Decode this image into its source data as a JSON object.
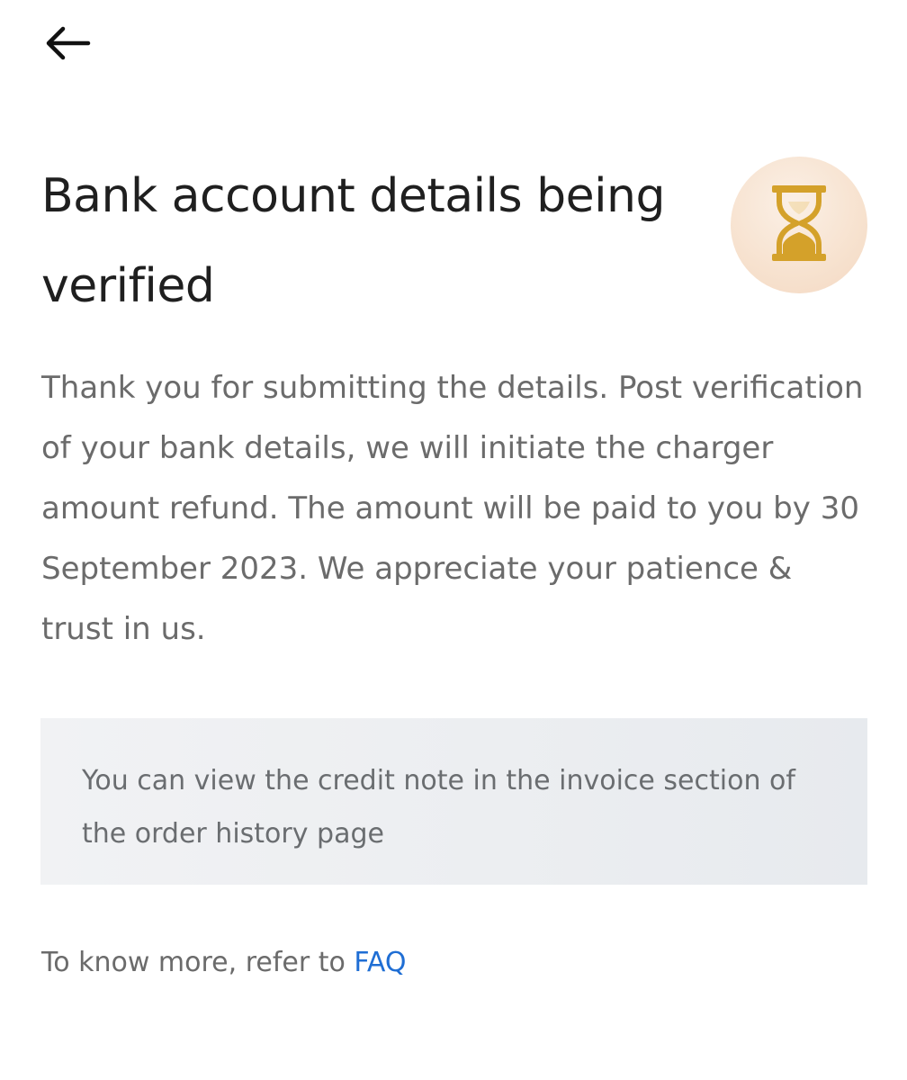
{
  "header": {
    "back_icon": "arrow-left-icon"
  },
  "status": {
    "title": "Bank account details being verified",
    "icon": "hourglass-icon",
    "icon_color": "#d4a12a",
    "circle_color": "#f7e2cf"
  },
  "message": {
    "body": "Thank you for submitting the details. Post verification of your bank details, we will initiate the charger amount refund. The amount will be paid to you by 30 September 2023. We appreciate your patience & trust in us."
  },
  "info_box": {
    "text": "You can view the credit note in the invoice section of the order history page"
  },
  "footer": {
    "prefix": "To know more, refer to",
    "link_label": "FAQ",
    "link_color": "#1f6ed4"
  }
}
